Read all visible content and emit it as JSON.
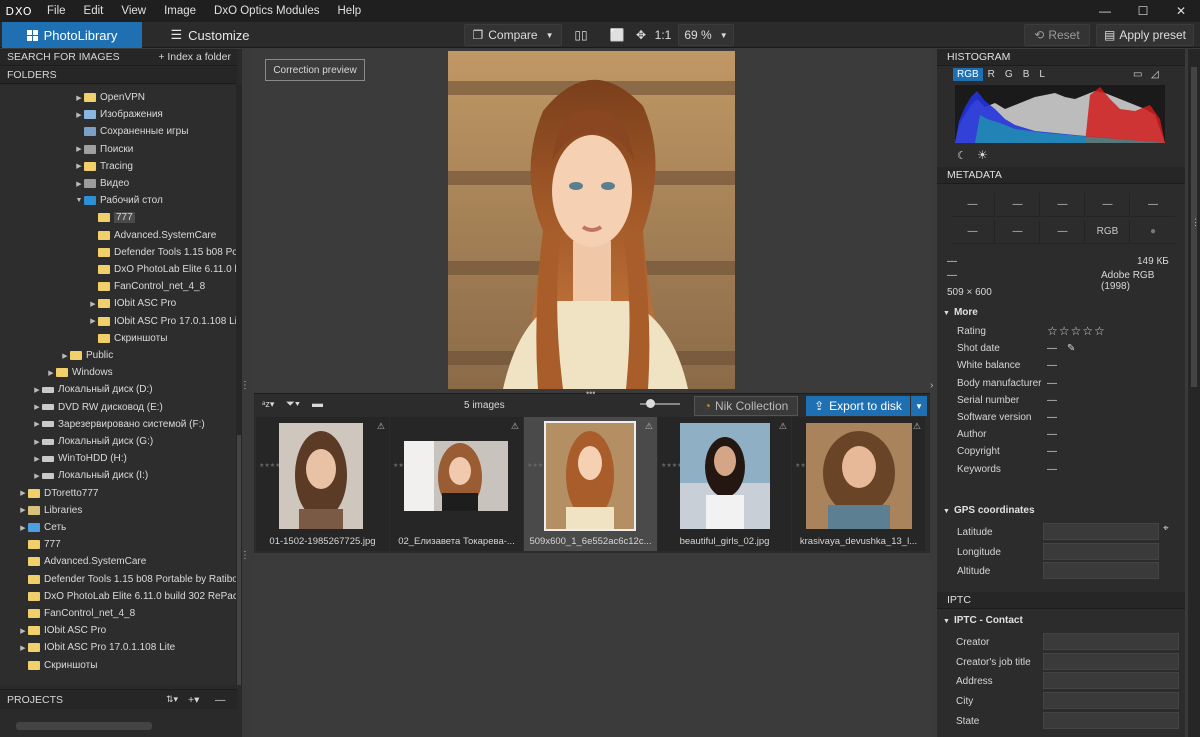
{
  "menubar": {
    "logo": "DXO",
    "items": [
      "File",
      "Edit",
      "View",
      "Image",
      "DxO Optics Modules",
      "Help"
    ],
    "minimize": "—",
    "maximize": "☐",
    "close": "✕"
  },
  "toolbar": {
    "photolibrary": "PhotoLibrary",
    "customize": "Customize",
    "compare": "Compare",
    "zoom_1to1": "1:1",
    "zoom_value": "69 %",
    "reset": "Reset",
    "apply_preset": "Apply preset"
  },
  "left": {
    "search_label": "SEARCH FOR IMAGES",
    "index_folder": "+ Index a folder",
    "folders_label": "FOLDERS",
    "projects_label": "PROJECTS",
    "tree": [
      {
        "label": "OpenVPN",
        "indent": 74,
        "type": "folder",
        "arrow": "▶"
      },
      {
        "label": "Изображения",
        "indent": 74,
        "type": "pic",
        "arrow": "▶"
      },
      {
        "label": "Сохраненные игры",
        "indent": 74,
        "type": "game",
        "arrow": ""
      },
      {
        "label": "Поиски",
        "indent": 74,
        "type": "search",
        "arrow": "▶"
      },
      {
        "label": "Tracing",
        "indent": 74,
        "type": "folder",
        "arrow": "▶"
      },
      {
        "label": "Видео",
        "indent": 74,
        "type": "video",
        "arrow": "▶"
      },
      {
        "label": "Рабочий стол",
        "indent": 74,
        "type": "desk",
        "arrow": "▼"
      },
      {
        "label": "777",
        "indent": 88,
        "type": "folder",
        "arrow": "",
        "selected": true
      },
      {
        "label": "Advanced.SystemCare",
        "indent": 88,
        "type": "folder",
        "arrow": ""
      },
      {
        "label": "Defender Tools 1.15 b08 Port",
        "indent": 88,
        "type": "folder",
        "arrow": ""
      },
      {
        "label": "DxO PhotoLab Elite 6.11.0 bu",
        "indent": 88,
        "type": "folder",
        "arrow": ""
      },
      {
        "label": "FanControl_net_4_8",
        "indent": 88,
        "type": "folder",
        "arrow": ""
      },
      {
        "label": "IObit ASC Pro",
        "indent": 88,
        "type": "folder",
        "arrow": "▶"
      },
      {
        "label": "IObit ASC Pro 17.0.1.108 Lite",
        "indent": 88,
        "type": "folder",
        "arrow": "▶"
      },
      {
        "label": "Скриншоты",
        "indent": 88,
        "type": "folder",
        "arrow": ""
      },
      {
        "label": "Public",
        "indent": 60,
        "type": "folder",
        "arrow": "▶"
      },
      {
        "label": "Windows",
        "indent": 46,
        "type": "folder",
        "arrow": "▶"
      },
      {
        "label": "Локальный диск (D:)",
        "indent": 32,
        "type": "drive",
        "arrow": "▶"
      },
      {
        "label": "DVD RW дисковод (E:)",
        "indent": 32,
        "type": "drive",
        "arrow": "▶"
      },
      {
        "label": "Зарезервировано системой (F:)",
        "indent": 32,
        "type": "drive",
        "arrow": "▶"
      },
      {
        "label": "Локальный диск (G:)",
        "indent": 32,
        "type": "drive",
        "arrow": "▶"
      },
      {
        "label": "WinToHDD (H:)",
        "indent": 32,
        "type": "drive",
        "arrow": "▶"
      },
      {
        "label": "Локальный диск (I:)",
        "indent": 32,
        "type": "drive",
        "arrow": "▶"
      },
      {
        "label": "DToretto777",
        "indent": 18,
        "type": "folder",
        "arrow": "▶"
      },
      {
        "label": "Libraries",
        "indent": 18,
        "type": "lib",
        "arrow": "▶"
      },
      {
        "label": "Сеть",
        "indent": 18,
        "type": "net",
        "arrow": "▶"
      },
      {
        "label": "777",
        "indent": 18,
        "type": "folder",
        "arrow": ""
      },
      {
        "label": "Advanced.SystemCare",
        "indent": 18,
        "type": "folder",
        "arrow": ""
      },
      {
        "label": "Defender Tools 1.15 b08 Portable by Ratibor",
        "indent": 18,
        "type": "folder",
        "arrow": ""
      },
      {
        "label": "DxO PhotoLab Elite 6.11.0 build 302 RePack",
        "indent": 18,
        "type": "folder",
        "arrow": ""
      },
      {
        "label": "FanControl_net_4_8",
        "indent": 18,
        "type": "folder",
        "arrow": ""
      },
      {
        "label": "IObit ASC Pro",
        "indent": 18,
        "type": "folder",
        "arrow": "▶"
      },
      {
        "label": "IObit ASC Pro 17.0.1.108 Lite",
        "indent": 18,
        "type": "folder",
        "arrow": "▶"
      },
      {
        "label": "Скриншоты",
        "indent": 18,
        "type": "folder",
        "arrow": ""
      }
    ]
  },
  "viewer": {
    "correction_preview": "Correction preview"
  },
  "filmbar": {
    "count": "5 images",
    "nik": "Nik Collection",
    "export": "Export to disk"
  },
  "thumbs": [
    {
      "name": "01-1502-1985267725.jpg",
      "stars": "★★★★★"
    },
    {
      "name": "02_Елизавета Токарева-...",
      "stars": "★★★★★"
    },
    {
      "name": "509x600_1_6e552ac6c12c...",
      "stars": "★★★★★"
    },
    {
      "name": "beautiful_girls_02.jpg",
      "stars": "★★★★★"
    },
    {
      "name": "krasivaya_devushka_13_l...",
      "stars": "★★★★★"
    }
  ],
  "right": {
    "histogram": "HISTOGRAM",
    "channels": [
      "RGB",
      "R",
      "G",
      "B",
      "L"
    ],
    "metadata": "METADATA",
    "grid_top": [
      "—",
      "—",
      "—",
      "—",
      "—"
    ],
    "grid_bottom": [
      "—",
      "—",
      "—",
      "RGB"
    ],
    "size": "149 КБ",
    "dash1": "—",
    "colorspace": "Adobe RGB (1998)",
    "dash2": "—",
    "dims": "509 × 600",
    "more": "More",
    "fields": [
      {
        "label": "Rating",
        "value": "☆☆☆☆☆"
      },
      {
        "label": "Shot date",
        "value": "—"
      },
      {
        "label": "White balance",
        "value": "—"
      },
      {
        "label": "Body manufacturer",
        "value": "—"
      },
      {
        "label": "Serial number",
        "value": "—"
      },
      {
        "label": "Software version",
        "value": "—"
      },
      {
        "label": "Author",
        "value": "—"
      },
      {
        "label": "Copyright",
        "value": "—"
      },
      {
        "label": "Keywords",
        "value": "—"
      }
    ],
    "gps": "GPS coordinates",
    "gps_fields": [
      "Latitude",
      "Longitude",
      "Altitude"
    ],
    "iptc": "IPTC",
    "iptc_contact": "IPTC - Contact",
    "iptc_fields": [
      "Creator",
      "Creator's job title",
      "Address",
      "City",
      "State"
    ]
  },
  "colors": {
    "accent": "#1f6fb3",
    "bg": "#3a3a3a",
    "panel": "#2c2c2c"
  }
}
